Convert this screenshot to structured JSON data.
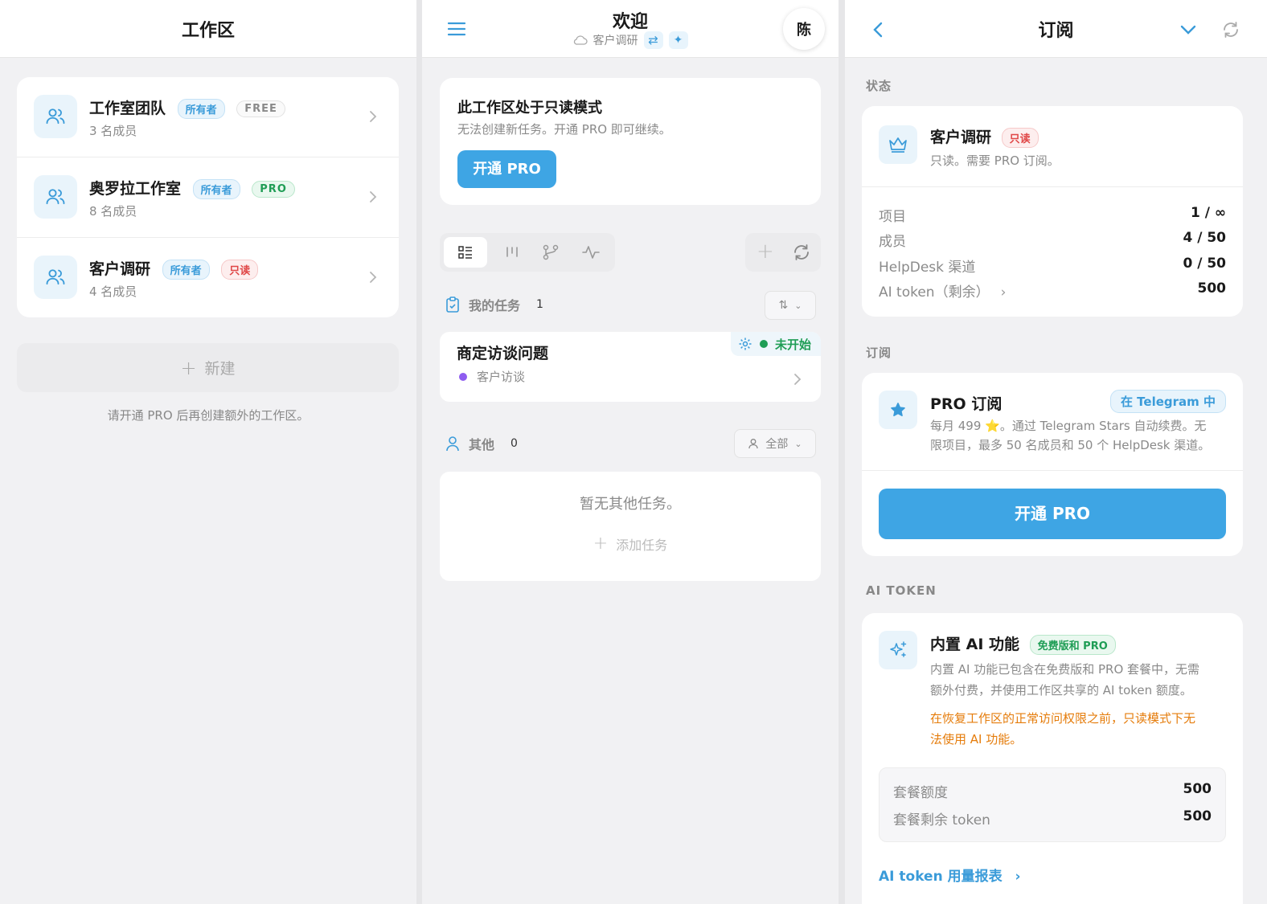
{
  "workspaces_panel": {
    "title": "工作区",
    "items": [
      {
        "name": "工作室团队",
        "role": "所有者",
        "plan": "FREE",
        "members": "3 名成员"
      },
      {
        "name": "奥罗拉工作室",
        "role": "所有者",
        "plan": "PRO",
        "members": "8 名成员"
      },
      {
        "name": "客户调研",
        "role": "所有者",
        "plan": "只读",
        "members": "4 名成员"
      }
    ],
    "new_button": "新建",
    "footer_note": "请开通 PRO 后再创建额外的工作区。"
  },
  "tasks_panel": {
    "title": "欢迎",
    "subtitle": "客户调研",
    "avatar": "陈",
    "readonly_banner": {
      "title": "此工作区处于只读模式",
      "desc": "无法创建新任务。开通 PRO 即可继续。",
      "button": "开通 PRO"
    },
    "view_tabs": [
      "list-icon",
      "kanban-icon",
      "branch-icon",
      "activity-icon"
    ],
    "my_tasks": {
      "label": "我的任务",
      "count": "1"
    },
    "task": {
      "title": "商定访谈问题",
      "status": "未开始",
      "tag": "客户访谈"
    },
    "others": {
      "label": "其他",
      "count": "0",
      "filter": "全部"
    },
    "empty_text": "暂无其他任务。",
    "add_task": "添加任务",
    "colors": {
      "accent": "#3ea5e4",
      "status_green": "#1f9d55",
      "tag_purple": "#8e5cf0"
    }
  },
  "subscription_panel": {
    "title": "订阅",
    "status_label": "状态",
    "status_card": {
      "name": "客户调研",
      "badge": "只读",
      "desc": "只读。需要 PRO 订阅。",
      "rows": [
        {
          "k": "项目",
          "v": "1 / ∞"
        },
        {
          "k": "成员",
          "v": "4 / 50"
        },
        {
          "k": "HelpDesk 渠道",
          "v": "0 / 50"
        },
        {
          "k": "AI token（剩余）",
          "v": "500"
        }
      ]
    },
    "sub_label": "订阅",
    "pro_card": {
      "title": "PRO 订阅",
      "badge": "在 Telegram 中",
      "desc_line1": "每月 499 ⭐。通过 Telegram Stars 自动续费。无",
      "desc_line2": "限项目，最多 50 名成员和 50 个 HelpDesk 渠道。",
      "button": "开通 PRO"
    },
    "ai_label": "AI TOKEN",
    "ai_card": {
      "title": "内置 AI 功能",
      "badge": "免费版和 PRO",
      "desc_line1": "内置 AI 功能已包含在免费版和 PRO 套餐中，无需",
      "desc_line2": "额外付费，并使用工作区共享的 AI token 额度。",
      "warn_line1": "在恢复工作区的正常访问权限之前，只读模式下无",
      "warn_line2": "法使用 AI 功能。",
      "rows": [
        {
          "k": "套餐额度",
          "v": "500"
        },
        {
          "k": "套餐剩余 token",
          "v": "500"
        }
      ],
      "report_link": "AI token 用量报表"
    }
  }
}
